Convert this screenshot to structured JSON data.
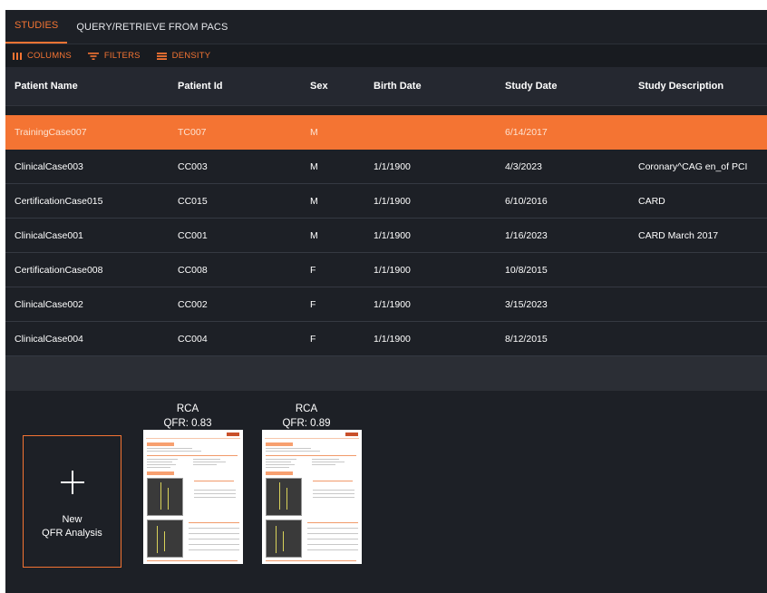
{
  "tabs": [
    {
      "label": "STUDIES",
      "active": true
    },
    {
      "label": "QUERY/RETRIEVE FROM PACS",
      "active": false
    }
  ],
  "toolbar": {
    "columns": "COLUMNS",
    "filters": "FILTERS",
    "density": "DENSITY"
  },
  "table": {
    "headers": [
      "Patient Name",
      "Patient Id",
      "Sex",
      "Birth Date",
      "Study Date",
      "Study Description"
    ],
    "rows": [
      {
        "name": "TrainingCase007",
        "id": "TC007",
        "sex": "M",
        "birth": "",
        "study_date": "6/14/2017",
        "desc": "",
        "selected": true
      },
      {
        "name": "ClinicalCase003",
        "id": "CC003",
        "sex": "M",
        "birth": "1/1/1900",
        "study_date": "4/3/2023",
        "desc": "Coronary^CAG en_of PCI"
      },
      {
        "name": "CertificationCase015",
        "id": "CC015",
        "sex": "M",
        "birth": "1/1/1900",
        "study_date": "6/10/2016",
        "desc": "CARD"
      },
      {
        "name": "ClinicalCase001",
        "id": "CC001",
        "sex": "M",
        "birth": "1/1/1900",
        "study_date": "1/16/2023",
        "desc": "CARD March 2017"
      },
      {
        "name": "CertificationCase008",
        "id": "CC008",
        "sex": "F",
        "birth": "1/1/1900",
        "study_date": "10/8/2015",
        "desc": ""
      },
      {
        "name": "ClinicalCase002",
        "id": "CC002",
        "sex": "F",
        "birth": "1/1/1900",
        "study_date": "3/15/2023",
        "desc": ""
      },
      {
        "name": "ClinicalCase004",
        "id": "CC004",
        "sex": "F",
        "birth": "1/1/1900",
        "study_date": "8/12/2015",
        "desc": ""
      }
    ]
  },
  "analysis": {
    "new_line1": "New",
    "new_line2": "QFR Analysis",
    "reports": [
      {
        "vessel": "RCA",
        "qfr": "QFR: 0.83"
      },
      {
        "vessel": "RCA",
        "qfr": "QFR: 0.89"
      }
    ]
  },
  "colors": {
    "accent": "#f47433",
    "background": "#1d2026",
    "header": "#252830"
  },
  "icons": [
    "columns-icon",
    "filter-icon",
    "density-icon",
    "plus-icon"
  ]
}
